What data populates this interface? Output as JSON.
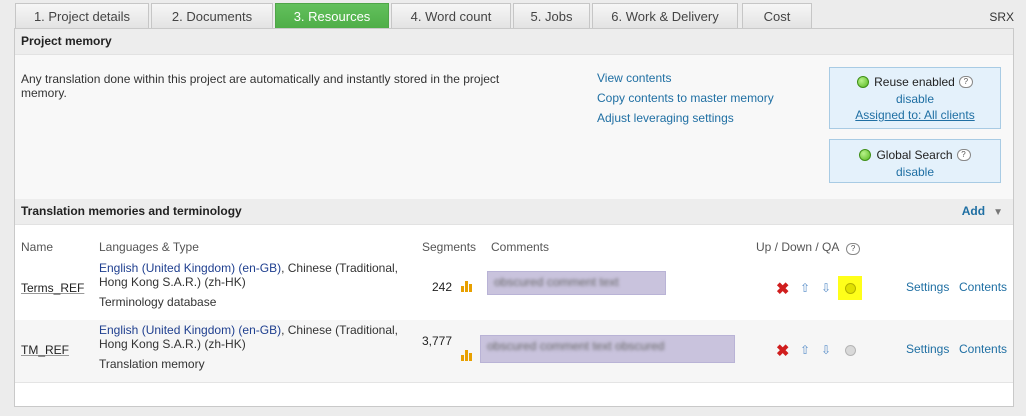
{
  "tabs": [
    {
      "label": "1. Project details",
      "active": false
    },
    {
      "label": "2. Documents",
      "active": false
    },
    {
      "label": "3. Resources",
      "active": true
    },
    {
      "label": "4. Word count",
      "active": false
    },
    {
      "label": "5. Jobs",
      "active": false
    },
    {
      "label": "6. Work & Delivery",
      "active": false
    },
    {
      "label": "Cost",
      "active": false
    }
  ],
  "top_right_label": "SRX",
  "project_memory": {
    "title": "Project memory",
    "description": "Any translation done within this project are automatically and instantly stored in the project memory.",
    "links": [
      "View contents",
      "Copy contents to master memory",
      "Adjust leveraging settings"
    ],
    "reuse": {
      "label": "Reuse enabled",
      "disable": "disable",
      "assigned": "Assigned to: All clients"
    },
    "global_search": {
      "label": "Global Search",
      "disable": "disable"
    }
  },
  "tm_section": {
    "title": "Translation memories and terminology",
    "add_label": "Add",
    "columns": {
      "name": "Name",
      "languages": "Languages & Type",
      "segments": "Segments",
      "comments": "Comments",
      "updown": "Up / Down / QA"
    },
    "rows": [
      {
        "name": "Terms_REF",
        "lang_source": "English (United Kingdom) (en-GB)",
        "lang_target_1": ", Chinese (Traditional,",
        "lang_target_2": "Hong Kong S.A.R.) (zh-HK)",
        "type": "Terminology database",
        "segments": "242",
        "comment": "obscured comment text",
        "settings": "Settings",
        "contents": "Contents"
      },
      {
        "name": "TM_REF",
        "lang_source": "English (United Kingdom) (en-GB)",
        "lang_target_1": ", Chinese (Traditional,",
        "lang_target_2": "Hong Kong S.A.R.) (zh-HK)",
        "type": "Translation memory",
        "segments": "3,777",
        "comment": "obscured comment text obscured",
        "settings": "Settings",
        "contents": "Contents"
      }
    ]
  },
  "colors": {
    "active_tab": "#5cb85c",
    "link": "#1f6fa3",
    "highlight": "#ffff1a"
  }
}
